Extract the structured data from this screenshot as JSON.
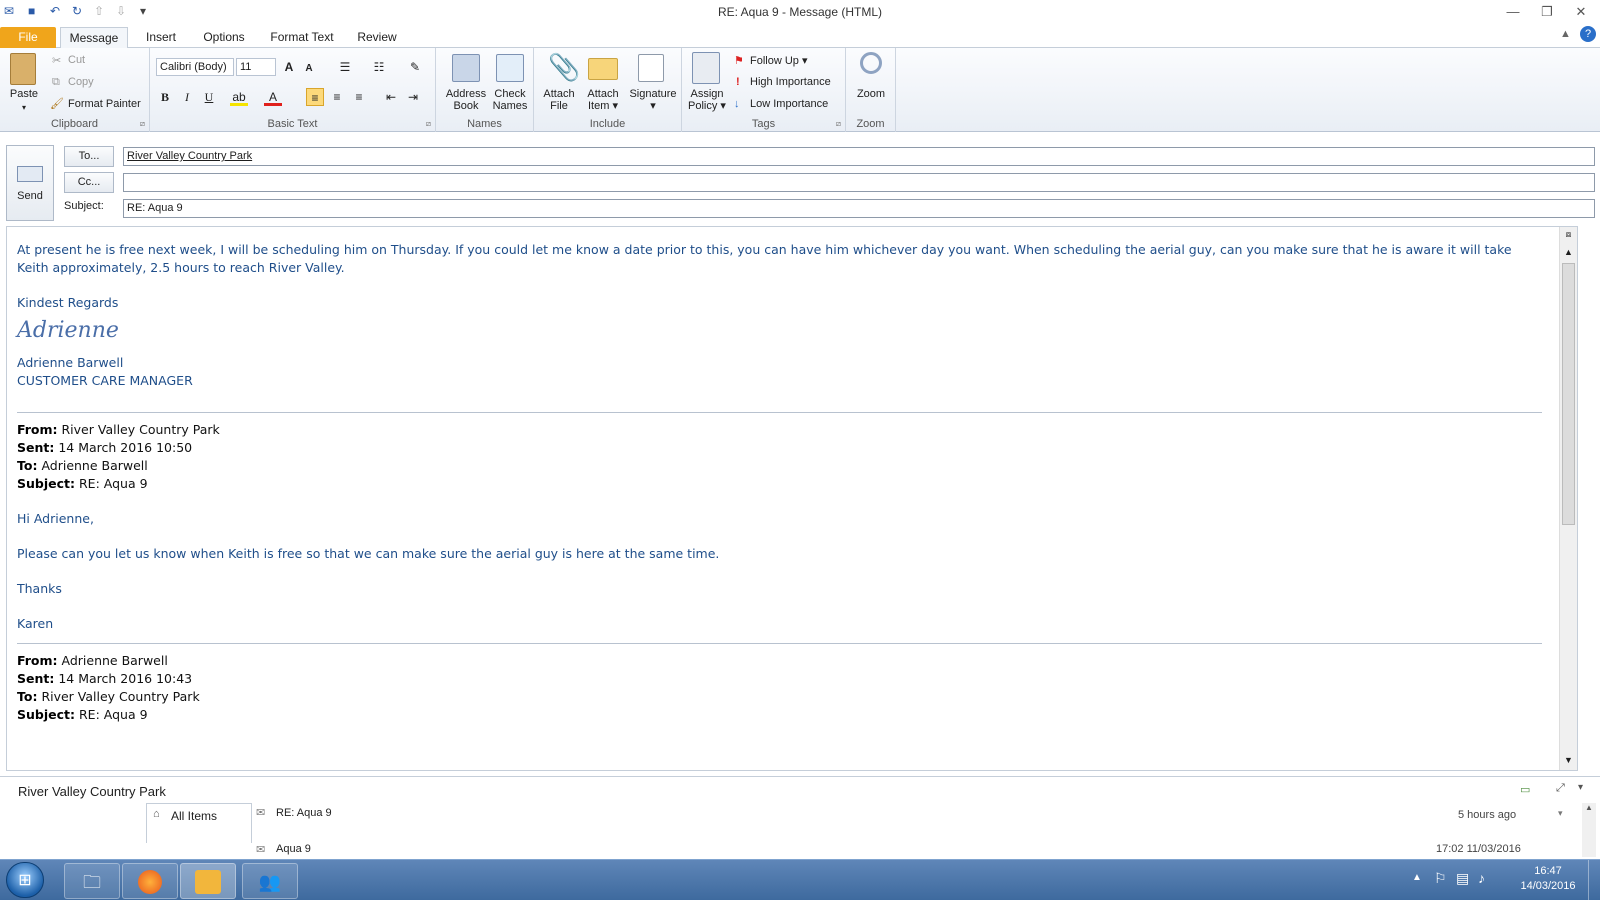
{
  "window": {
    "title": "RE: Aqua 9  -  Message (HTML)"
  },
  "tabs": {
    "file": "File",
    "message": "Message",
    "insert": "Insert",
    "options": "Options",
    "format_text": "Format Text",
    "review": "Review"
  },
  "clipboard": {
    "paste": "Paste",
    "cut": "Cut",
    "copy": "Copy",
    "format_painter": "Format Painter",
    "label": "Clipboard"
  },
  "basic_text": {
    "font": "Calibri (Body)",
    "size": "11",
    "label": "Basic Text"
  },
  "names": {
    "address_book_1": "Address",
    "address_book_2": "Book",
    "check_names_1": "Check",
    "check_names_2": "Names",
    "label": "Names"
  },
  "include": {
    "attach_file_1": "Attach",
    "attach_file_2": "File",
    "attach_item_1": "Attach",
    "attach_item_2": "Item",
    "signature": "Signature",
    "label": "Include"
  },
  "tags": {
    "assign_policy_1": "Assign",
    "assign_policy_2": "Policy",
    "follow_up": "Follow Up",
    "high_importance": "High Importance",
    "low_importance": "Low Importance",
    "label": "Tags"
  },
  "zoom": {
    "zoom": "Zoom",
    "label": "Zoom"
  },
  "header": {
    "send": "Send",
    "to_button": "To...",
    "cc_button": "Cc...",
    "subject_label": "Subject:",
    "to_value": "River Valley Country Park",
    "cc_value": "",
    "subject_value": "RE: Aqua 9"
  },
  "message": {
    "p1": "At present he is free next week, I will be scheduling him on Thursday.  If you could let me know a date prior to this, you can have him whichever day you  want. When scheduling the aerial guy, can you make sure that he is aware it will take Keith approximately, 2.5 hours to reach River Valley.",
    "regards": "Kindest Regards",
    "signature_script": "Adrienne",
    "sig_name": "Adrienne Barwell",
    "sig_title": "CUSTOMER CARE MANAGER",
    "q1": {
      "from_label": "From:",
      "from": "River Valley Country Park",
      "sent_label": "Sent:",
      "sent": "14 March 2016 10:50",
      "to_label": "To:",
      "to": "Adrienne Barwell",
      "subject_label": "Subject:",
      "subject": "RE: Aqua 9"
    },
    "q1_greeting": "Hi Adrienne,",
    "q1_body": "Please can you let us know when Keith is free so that we can make sure the aerial guy is here at the same time.",
    "q1_thanks": "Thanks",
    "q1_name": "Karen",
    "q2": {
      "from_label": "From:",
      "from": "Adrienne Barwell",
      "sent_label": "Sent:",
      "sent": "14 March 2016 10:43",
      "to_label": "To:",
      "to": "River Valley Country Park",
      "subject_label": "Subject:",
      "subject": "RE: Aqua 9"
    }
  },
  "people_pane": {
    "contact": "River Valley Country Park",
    "all_items": "All Items",
    "items": [
      {
        "subject": "RE: Aqua 9",
        "time": "5 hours ago"
      },
      {
        "subject": "Aqua 9",
        "time": "17:02 11/03/2016"
      }
    ]
  },
  "taskbar": {
    "time": "16:47",
    "date": "14/03/2016"
  }
}
